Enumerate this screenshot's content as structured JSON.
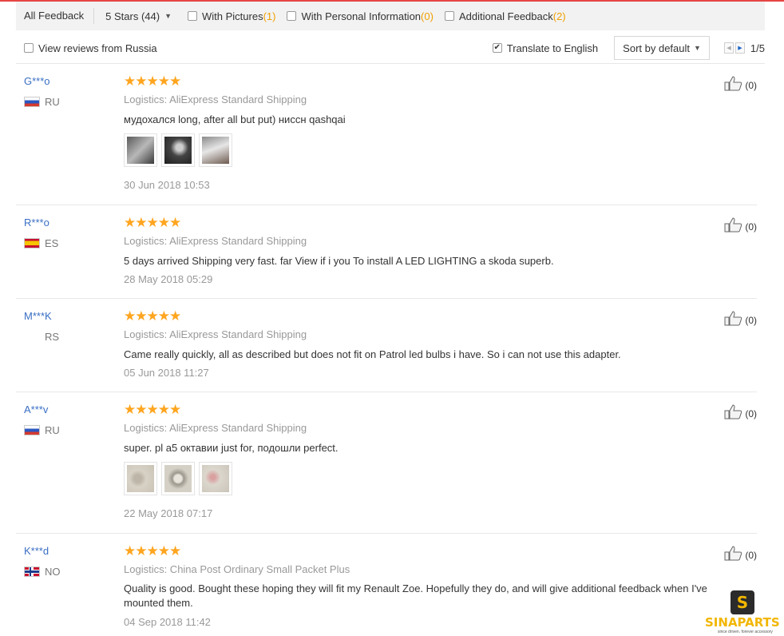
{
  "filters": {
    "all_feedback": "All Feedback",
    "stars_select": "5 Stars (44)",
    "with_pictures": {
      "label": "With Pictures",
      "count": "(1)"
    },
    "with_personal_info": {
      "label": "With Personal Information",
      "count": "(0)"
    },
    "additional_feedback": {
      "label": "Additional Feedback",
      "count": "(2)"
    }
  },
  "options": {
    "view_country": "View reviews from Russia",
    "translate": "Translate to English",
    "translate_checked": true,
    "sort": "Sort by default",
    "page": "1/5"
  },
  "reviews": [
    {
      "user": "G***o",
      "country": "RU",
      "flag": "flag-ru",
      "stars": "★★★★★",
      "logistics": "Logistics: AliExpress Standard Shipping",
      "text": "мудохался long, after all but put) ниссн qashqai",
      "date": "30 Jun 2018 10:53",
      "helpful": "(0)",
      "photos": [
        "photo-1",
        "photo-2",
        "photo-3"
      ]
    },
    {
      "user": "R***o",
      "country": "ES",
      "flag": "flag-es",
      "stars": "★★★★★",
      "logistics": "Logistics: AliExpress Standard Shipping",
      "text": "5 days arrived Shipping very fast. far View if i you To install A LED LIGHTING a skoda superb.",
      "date": "28 May 2018 05:29",
      "helpful": "(0)"
    },
    {
      "user": "M***K",
      "country": "RS",
      "flag": "flag-none",
      "stars": "★★★★★",
      "logistics": "Logistics: AliExpress Standard Shipping",
      "text": "Came really quickly, all as described but does not fit on Patrol led bulbs i have. So i can not use this adapter.",
      "date": "05 Jun 2018 11:27",
      "helpful": "(0)"
    },
    {
      "user": "A***v",
      "country": "RU",
      "flag": "flag-ru",
      "stars": "★★★★★",
      "logistics": "Logistics: AliExpress Standard Shipping",
      "text": "super. pl a5 октавии just for, подошли perfect.",
      "date": "22 May 2018 07:17",
      "helpful": "(0)",
      "photos": [
        "photo-1",
        "photo-2",
        "photo-3"
      ]
    },
    {
      "user": "K***d",
      "country": "NO",
      "flag": "flag-no",
      "stars": "★★★★★",
      "logistics": "Logistics: China Post Ordinary Small Packet Plus",
      "text": "Quality is good. Bought these hoping they will fit my Renault Zoe. Hopefully they do, and will give additional feedback when I've mounted them.",
      "date": "04 Sep 2018 11:42",
      "helpful": "(0)"
    }
  ],
  "watermark": {
    "badge": "S",
    "name": "SINAPARTS",
    "tagline": "since driven. forever accessory"
  },
  "colors": {
    "accent_red": "#e64545",
    "star": "#ffa51f",
    "link_blue": "#3a6fc4",
    "count_orange": "#f0a000"
  }
}
